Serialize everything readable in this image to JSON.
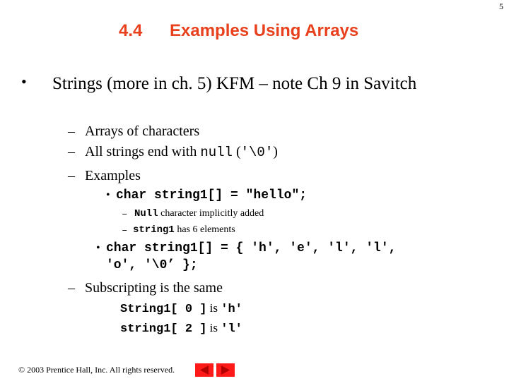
{
  "page_number": "5",
  "title": {
    "number": "4.4",
    "text": "Examples Using Arrays"
  },
  "content": {
    "main_bullet": "Strings (more in ch. 5) KFM – note Ch 9 in Savitch",
    "sub_items": {
      "arrays_of_characters": "Arrays of characters",
      "null_end_prefix": "All strings end with ",
      "null_end_code": "null",
      "null_end_open": " (",
      "null_end_literal": "'\\0'",
      "null_end_close": ")",
      "examples": "Examples",
      "example1_code": "char string1[] = \"hello\";",
      "example1_note1_code": "Null",
      "example1_note1_text": " character implicitly added",
      "example1_note2_code": "string1",
      "example1_note2_text": " has 6 elements",
      "example2_code_line1": "char string1[] = { 'h', 'e', 'l', 'l',",
      "example2_code_line2": "'o', '\\0’ };",
      "subscripting": "Subscripting is the same",
      "sub_line1_code": "String1[ 0 ]",
      "sub_line1_is": " is ",
      "sub_line1_val": "'h'",
      "sub_line2_code": "string1[ 2 ]",
      "sub_line2_is": " is ",
      "sub_line2_val": "'l'"
    },
    "dash": "–",
    "bullet": "•"
  },
  "footer": {
    "copyright": "© 2003 Prentice Hall, Inc.  All rights reserved.",
    "prev_icon": "triangle-left-icon",
    "next_icon": "triangle-right-icon"
  },
  "colors": {
    "title": "#e8401c",
    "nav_button": "#ff1a1a",
    "nav_arrow": "#b30000"
  }
}
